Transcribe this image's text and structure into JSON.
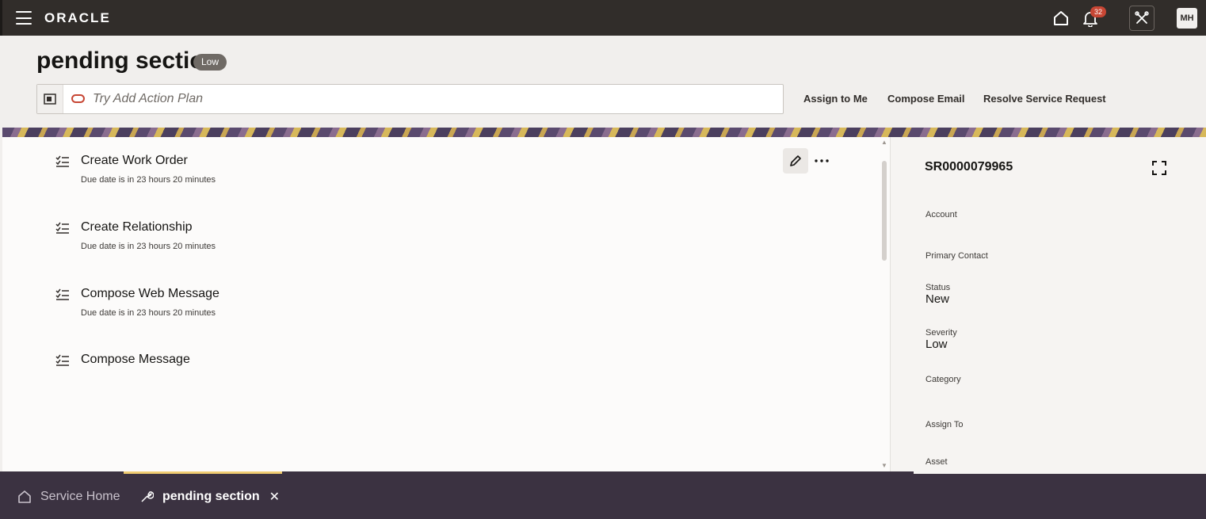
{
  "topbar": {
    "logo": "ORACLE",
    "notification_count": "32",
    "user_initials": "MH",
    "icons": [
      "menu-icon",
      "home-icon",
      "bell-icon",
      "tools-icon"
    ]
  },
  "header": {
    "title": "pending section",
    "badge": "Low",
    "search_placeholder": "Try Add Action Plan",
    "actions": {
      "assign_to_me": "Assign to Me",
      "compose_email": "Compose Email",
      "resolve": "Resolve Service Request"
    }
  },
  "tasks": [
    {
      "title": "Create Work Order",
      "due": "Due date is in 23 hours 20 minutes"
    },
    {
      "title": "Create Relationship",
      "due": "Due date is in 23 hours 20 minutes"
    },
    {
      "title": "Compose Web Message",
      "due": "Due date is in 23 hours 20 minutes"
    },
    {
      "title": "Compose Message",
      "due": ""
    }
  ],
  "details": {
    "sr_number": "SR0000079965",
    "account_label": "Account",
    "primary_contact_label": "Primary Contact",
    "status_label": "Status",
    "status_value": "New",
    "severity_label": "Severity",
    "severity_value": "Low",
    "category_label": "Category",
    "assign_to_label": "Assign To",
    "asset_label": "Asset"
  },
  "bottom_tabs": {
    "home": "Service Home",
    "pending": "pending section"
  },
  "colors": {
    "topbar": "#312d2a",
    "oracle_red": "#c74634",
    "tab_bar": "#3b3241",
    "active_tab_indicator": "#f0cc71"
  }
}
